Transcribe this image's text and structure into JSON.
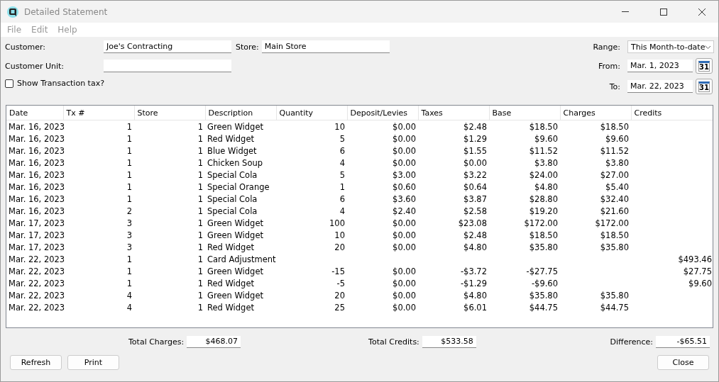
{
  "window": {
    "title": "Detailed Statement"
  },
  "menu": [
    "File",
    "Edit",
    "Help"
  ],
  "customer": {
    "label": "Customer:",
    "value": "Joe's Contracting"
  },
  "store": {
    "label": "Store:",
    "value": "Main Store"
  },
  "customer_unit": {
    "label": "Customer Unit:"
  },
  "show_tax": {
    "label": "Show Transaction tax?",
    "checked": false
  },
  "range": {
    "label": "Range:",
    "value": "This Month-to-date"
  },
  "from": {
    "label": "From:",
    "value": "Mar. 1, 2023",
    "calendar": "31"
  },
  "to": {
    "label": "To:",
    "value": "Mar. 22, 2023",
    "calendar": "31"
  },
  "table": {
    "columns": [
      "Date",
      "Tx #",
      "Store",
      "Description",
      "Quantity",
      "Deposit/Levies",
      "Taxes",
      "Base",
      "Charges",
      "Credits"
    ],
    "rows": [
      {
        "date": "Mar. 16, 2023",
        "tx": "1",
        "store": "1",
        "description": "Green Widget",
        "quantity": "10",
        "deposit": "$0.00",
        "taxes": "$2.48",
        "base": "$18.50",
        "charges": "$18.50"
      },
      {
        "date": "Mar. 16, 2023",
        "tx": "1",
        "store": "1",
        "description": "Red Widget",
        "quantity": "5",
        "deposit": "$0.00",
        "taxes": "$1.29",
        "base": "$9.60",
        "charges": "$9.60"
      },
      {
        "date": "Mar. 16, 2023",
        "tx": "1",
        "store": "1",
        "description": "Blue Widget",
        "quantity": "6",
        "deposit": "$0.00",
        "taxes": "$1.55",
        "base": "$11.52",
        "charges": "$11.52"
      },
      {
        "date": "Mar. 16, 2023",
        "tx": "1",
        "store": "1",
        "description": "Chicken Soup",
        "quantity": "4",
        "deposit": "$0.00",
        "taxes": "$0.00",
        "base": "$3.80",
        "charges": "$3.80"
      },
      {
        "date": "Mar. 16, 2023",
        "tx": "1",
        "store": "1",
        "description": "Special Cola",
        "quantity": "5",
        "deposit": "$3.00",
        "taxes": "$3.22",
        "base": "$24.00",
        "charges": "$27.00"
      },
      {
        "date": "Mar. 16, 2023",
        "tx": "1",
        "store": "1",
        "description": "Special Orange",
        "quantity": "1",
        "deposit": "$0.60",
        "taxes": "$0.64",
        "base": "$4.80",
        "charges": "$5.40"
      },
      {
        "date": "Mar. 16, 2023",
        "tx": "1",
        "store": "1",
        "description": "Special Cola",
        "quantity": "6",
        "deposit": "$3.60",
        "taxes": "$3.87",
        "base": "$28.80",
        "charges": "$32.40"
      },
      {
        "date": "Mar. 16, 2023",
        "tx": "2",
        "store": "1",
        "description": "Special Cola",
        "quantity": "4",
        "deposit": "$2.40",
        "taxes": "$2.58",
        "base": "$19.20",
        "charges": "$21.60"
      },
      {
        "date": "Mar. 17, 2023",
        "tx": "3",
        "store": "1",
        "description": "Green Widget",
        "quantity": "100",
        "deposit": "$0.00",
        "taxes": "$23.08",
        "base": "$172.00",
        "charges": "$172.00"
      },
      {
        "date": "Mar. 17, 2023",
        "tx": "3",
        "store": "1",
        "description": "Green Widget",
        "quantity": "10",
        "deposit": "$0.00",
        "taxes": "$2.48",
        "base": "$18.50",
        "charges": "$18.50"
      },
      {
        "date": "Mar. 17, 2023",
        "tx": "3",
        "store": "1",
        "description": "Red Widget",
        "quantity": "20",
        "deposit": "$0.00",
        "taxes": "$4.80",
        "base": "$35.80",
        "charges": "$35.80"
      },
      {
        "date": "Mar. 22, 2023",
        "tx": "1",
        "store": "1",
        "description": "Card Adjustment",
        "credits": "$493.46"
      },
      {
        "date": "Mar. 22, 2023",
        "tx": "1",
        "store": "1",
        "description": "Green Widget",
        "quantity": "-15",
        "deposit": "$0.00",
        "taxes": "-$3.72",
        "base": "-$27.75",
        "credits": "$27.75"
      },
      {
        "date": "Mar. 22, 2023",
        "tx": "1",
        "store": "1",
        "description": "Red Widget",
        "quantity": "-5",
        "deposit": "$0.00",
        "taxes": "-$1.29",
        "base": "-$9.60",
        "credits": "$9.60"
      },
      {
        "date": "Mar. 22, 2023",
        "tx": "4",
        "store": "1",
        "description": "Green Widget",
        "quantity": "20",
        "deposit": "$0.00",
        "taxes": "$4.80",
        "base": "$35.80",
        "charges": "$35.80"
      },
      {
        "date": "Mar. 22, 2023",
        "tx": "4",
        "store": "1",
        "description": "Red Widget",
        "quantity": "25",
        "deposit": "$0.00",
        "taxes": "$6.01",
        "base": "$44.75",
        "charges": "$44.75"
      }
    ]
  },
  "totals": [
    {
      "label": "Total Charges:",
      "value": "$468.07"
    },
    {
      "label": "Total Credits:",
      "value": "$533.58"
    },
    {
      "label": "Difference:",
      "value": "-$65.51"
    }
  ],
  "buttons": {
    "left": [
      "Refresh",
      "Print"
    ],
    "right": [
      "Close"
    ]
  }
}
